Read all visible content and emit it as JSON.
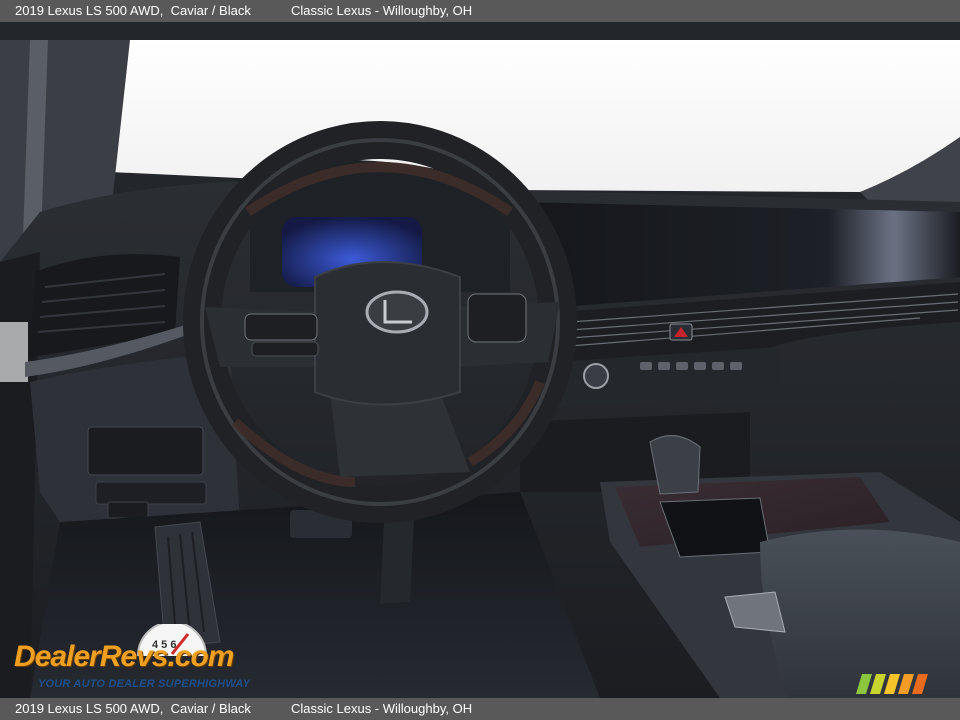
{
  "caption": {
    "vehicle": "2019 Lexus LS 500 AWD,",
    "color": "Caviar / Black",
    "dealer": "Classic Lexus - Willoughby, OH"
  },
  "watermark": {
    "brand": "DealerRevs.com",
    "tagline": "YOUR AUTO DEALER SUPERHIGHWAY",
    "gauge_digits": "4 5 6"
  },
  "colors": {
    "bar": "#595959",
    "logo_orange": "#f0a020",
    "logo_blue": "#2a6fb5",
    "interior_dark": "#23262b"
  }
}
